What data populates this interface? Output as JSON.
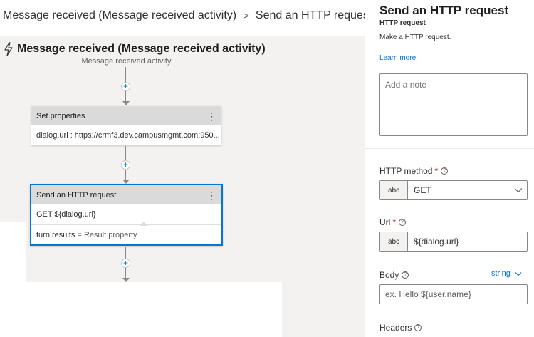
{
  "breadcrumb": {
    "items": [
      "Message received (Message received activity)",
      "Send an HTTP request"
    ],
    "separator": ">"
  },
  "trigger": {
    "title": "Message received (Message received activity)",
    "subtitle": "Message received activity"
  },
  "nodes": [
    {
      "title": "Set properties",
      "rows": [
        "dialog.url : https://crmf3.dev.campusmgmt.com:950..."
      ]
    },
    {
      "title": "Send an HTTP request",
      "rows": [
        "GET ${dialog.url}"
      ],
      "result_var": "turn.results",
      "result_label": "= Result property"
    }
  ],
  "add_symbol": "+",
  "more_symbol": "⋮",
  "panel": {
    "title": "Send an HTTP request",
    "kind": "HTTP request",
    "description": "Make a HTTP request.",
    "learn_more": "Learn more",
    "note_placeholder": "Add a note",
    "http_method": {
      "label": "HTTP method",
      "required": "*",
      "help": "?",
      "type": "abc",
      "value": "GET"
    },
    "url": {
      "label": "Url",
      "required": "*",
      "help": "?",
      "type": "abc",
      "value": "${dialog.url}"
    },
    "body": {
      "label": "Body",
      "help": "?",
      "type_select": "string",
      "placeholder": "ex. Hello ${user.name}"
    },
    "headers": {
      "label": "Headers",
      "help": "?"
    }
  },
  "colors": {
    "accent": "#0078d4",
    "canvas": "#f3f2f1",
    "node_header": "#dadada",
    "required": "#a4262c"
  },
  "icons": [
    "lightning-icon",
    "chevron-down-icon",
    "more-vertical-icon",
    "help-circle-icon",
    "add-circle-icon"
  ]
}
